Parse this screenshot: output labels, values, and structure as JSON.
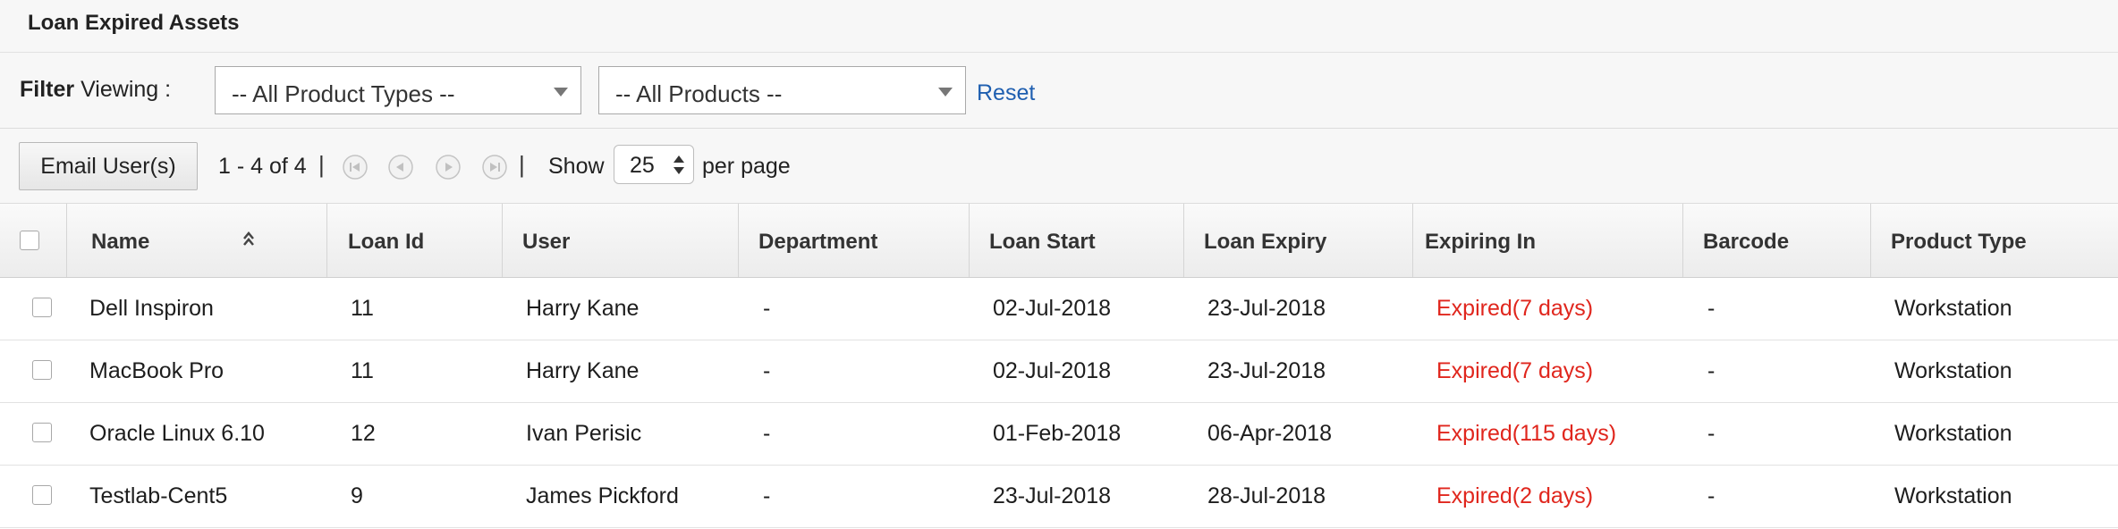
{
  "page": {
    "title": "Loan Expired Assets"
  },
  "filter": {
    "label_bold": "Filter",
    "label_rest": "Viewing :",
    "product_types": "-- All Product Types --",
    "products": "-- All Products --",
    "reset": "Reset"
  },
  "toolbar": {
    "email_button": "Email User(s)",
    "range": "1 - 4 of 4",
    "separator": "|",
    "show": "Show",
    "per_page_value": "25",
    "per_page": "per page"
  },
  "table": {
    "headers": [
      "Name",
      "Loan Id",
      "User",
      "Department",
      "Loan Start",
      "Loan Expiry",
      "Expiring In",
      "Barcode",
      "Product Type"
    ],
    "rows": [
      [
        "Dell Inspiron",
        "11",
        "Harry Kane",
        "-",
        "02-Jul-2018",
        "23-Jul-2018",
        "Expired(7 days)",
        "-",
        "Workstation"
      ],
      [
        "MacBook Pro",
        "11",
        "Harry Kane",
        "-",
        "02-Jul-2018",
        "23-Jul-2018",
        "Expired(7 days)",
        "-",
        "Workstation"
      ],
      [
        "Oracle Linux 6.10",
        "12",
        "Ivan Perisic",
        "-",
        "01-Feb-2018",
        "06-Apr-2018",
        "Expired(115 days)",
        "-",
        "Workstation"
      ],
      [
        "Testlab-Cent5",
        "9",
        "James Pickford",
        "-",
        "23-Jul-2018",
        "28-Jul-2018",
        "Expired(2 days)",
        "-",
        "Workstation"
      ]
    ]
  },
  "colors": {
    "expired": "#e0261d",
    "link": "#1f5fb0"
  },
  "icons": {
    "sort": "sort-ascending-icon",
    "first": "first-page-icon",
    "prev": "previous-page-icon",
    "next": "next-page-icon",
    "last": "last-page-icon"
  }
}
